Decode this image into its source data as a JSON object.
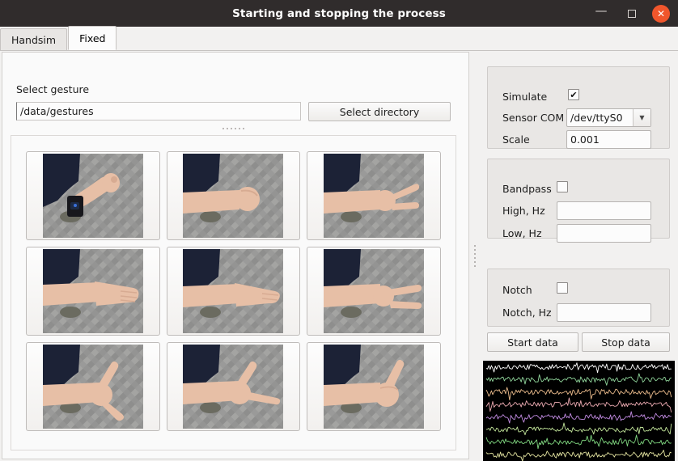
{
  "window": {
    "title": "Starting and stopping the process",
    "minimize_label": "—",
    "maximize_label": "",
    "close_label": "✕"
  },
  "tabs": [
    {
      "label": "Handsim",
      "active": false
    },
    {
      "label": "Fixed",
      "active": true
    }
  ],
  "left_panel": {
    "gesture_label": "Select gesture",
    "gesture_path_value": "/data/gestures",
    "gesture_path_placeholder": "",
    "select_directory_label": "Select directory",
    "gesture_images": [
      {
        "name": "fist-raised-with-armband",
        "alt": "Forearm with black sensor armband, hand closed in a fist raised upward"
      },
      {
        "name": "fist",
        "alt": "Forearm extended horizontally, hand closed in a fist"
      },
      {
        "name": "victory-sign",
        "alt": "Forearm extended, hand making a two-finger victory sign"
      },
      {
        "name": "open-palm-fingers-together",
        "alt": "Forearm extended, open flat hand, fingers together"
      },
      {
        "name": "flat-hand",
        "alt": "Forearm extended, flat hand pointing forward"
      },
      {
        "name": "two-fingers-spread",
        "alt": "Forearm extended, two fingers extended and spread"
      },
      {
        "name": "shaka-sign",
        "alt": "Forearm extended, thumb and little finger extended"
      },
      {
        "name": "pointing-finger",
        "alt": "Forearm extended, index finger pointing forward with thumb up"
      },
      {
        "name": "thumbs-up",
        "alt": "Forearm extended, hand closed with thumb pointing up"
      }
    ]
  },
  "right_panel": {
    "sensor_group": {
      "simulate_label": "Simulate",
      "simulate_checked": true,
      "simulate_check_glyph": "✔",
      "sensor_com_label": "Sensor COM",
      "sensor_com_value": "/dev/ttyS0",
      "sensor_com_arrow": "▼",
      "scale_label": "Scale",
      "scale_value": "0.001"
    },
    "bandpass_group": {
      "bandpass_label": "Bandpass",
      "bandpass_checked": false,
      "high_label": "High, Hz",
      "high_value": "",
      "low_label": "Low, Hz",
      "low_value": ""
    },
    "notch_group": {
      "notch_label": "Notch",
      "notch_checked": false,
      "notch_hz_label": "Notch, Hz",
      "notch_hz_value": ""
    },
    "start_button_label": "Start data",
    "stop_button_label": "Stop data"
  },
  "signal_plot": {
    "background": "#000000",
    "channel_count": 8,
    "channels": [
      {
        "name": "channel-1",
        "color": "#ffffff"
      },
      {
        "name": "channel-2",
        "color": "#8fd49a"
      },
      {
        "name": "channel-3",
        "color": "#e8b98a"
      },
      {
        "name": "channel-4",
        "color": "#eaa9b0"
      },
      {
        "name": "channel-5",
        "color": "#c08ae0"
      },
      {
        "name": "channel-6",
        "color": "#c2e59a"
      },
      {
        "name": "channel-7",
        "color": "#7fd67f"
      },
      {
        "name": "channel-8",
        "color": "#e3e3a0"
      }
    ]
  },
  "colors": {
    "titlebar": "#302c2c",
    "close_button": "#f0562c",
    "window_background": "#f2f1f0",
    "panel_background": "#fafafa",
    "group_background": "#e9e7e5"
  }
}
